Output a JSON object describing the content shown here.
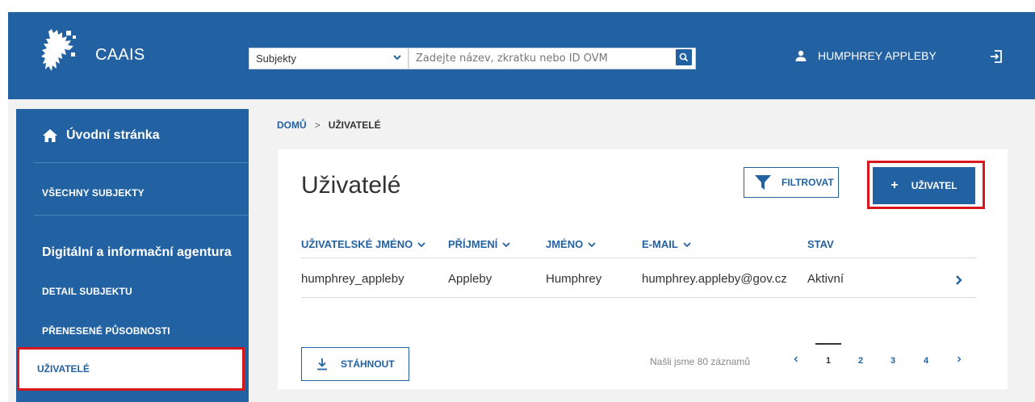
{
  "app": {
    "name": "CAAIS"
  },
  "search": {
    "scope": "Subjekty",
    "placeholder": "Zadejte název, zkratku nebo ID OVM"
  },
  "user": {
    "name": "HUMPHREY APPLEBY"
  },
  "sidebar": {
    "home": "Úvodní stránka",
    "all_subjects": "VŠECHNY SUBJEKTY",
    "section_title": "Digitální a informační agentura",
    "items": [
      {
        "label": "DETAIL SUBJEKTU"
      },
      {
        "label": "PŘENESENÉ PŮSOBNOSTI"
      },
      {
        "label": "UŽIVATELÉ"
      }
    ]
  },
  "breadcrumb": {
    "home": "DOMŮ",
    "separator": ">",
    "current": "UŽIVATELÉ"
  },
  "main": {
    "title": "Uživatelé",
    "filter_label": "FILTROVAT",
    "add_label": "UŽIVATEL",
    "add_plus": "+",
    "columns": [
      {
        "label": "UŽIVATELSKÉ JMÉNO"
      },
      {
        "label": "PŘÍJMENÍ"
      },
      {
        "label": "JMÉNO"
      },
      {
        "label": "E-MAIL"
      },
      {
        "label": "STAV"
      }
    ],
    "rows": [
      {
        "username": "humphrey_appleby",
        "surname": "Appleby",
        "first_name": "Humphrey",
        "email": "humphrey.appleby@gov.cz",
        "status": "Aktivní"
      }
    ],
    "download_label": "STÁHNOUT",
    "records_text": "Našli jsme 80 záznamů",
    "pages": [
      "1",
      "2",
      "3",
      "4"
    ],
    "current_page": "1"
  },
  "colors": {
    "primary": "#2362a2",
    "highlight": "#d9161c",
    "background": "#f2f2f2"
  },
  "icons": [
    "logo-icon",
    "chevron-down-icon",
    "search-icon",
    "user-icon",
    "logout-icon",
    "home-icon",
    "filter-icon",
    "chevron-right-icon",
    "download-icon",
    "chevron-left-icon"
  ]
}
